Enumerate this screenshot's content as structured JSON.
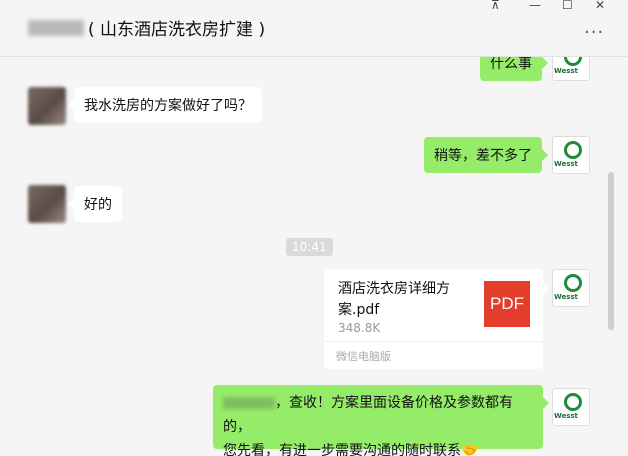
{
  "window": {
    "title": "( 山东酒店洗衣房扩建 )",
    "controls": {
      "pin": "⊼",
      "minimize": "—",
      "maximize": "☐",
      "close": "✕"
    },
    "more_label": "···"
  },
  "messages": [
    {
      "from": "me",
      "text": "什么事"
    },
    {
      "from": "other",
      "text": "我水洗房的方案做好了吗？"
    },
    {
      "from": "me",
      "text": "稍等，差不多了"
    },
    {
      "from": "other",
      "text": "好的"
    },
    {
      "type": "timestamp",
      "text": "10:41"
    },
    {
      "from": "me",
      "type": "file",
      "file_name": "酒店洗衣房详细方案.pdf",
      "file_size": "348.8K",
      "file_icon": "PDF",
      "source": "微信电脑版"
    },
    {
      "from": "me",
      "line1": "，查收！方案里面设备价格及参数都有的，",
      "line2": "您先看，有进一步需要沟通的随时联系",
      "emoji": "🤝"
    }
  ],
  "avatar_brand": "Wesst",
  "icons": {
    "my_avatar": "wesst-logo-icon",
    "other_avatar": "blurred-photo-avatar"
  },
  "colors": {
    "my_bubble": "#95ec69",
    "other_bubble": "#ffffff",
    "background": "#f5f5f5",
    "pdf": "#e33e2c",
    "brand_green": "#1e8a3a"
  }
}
